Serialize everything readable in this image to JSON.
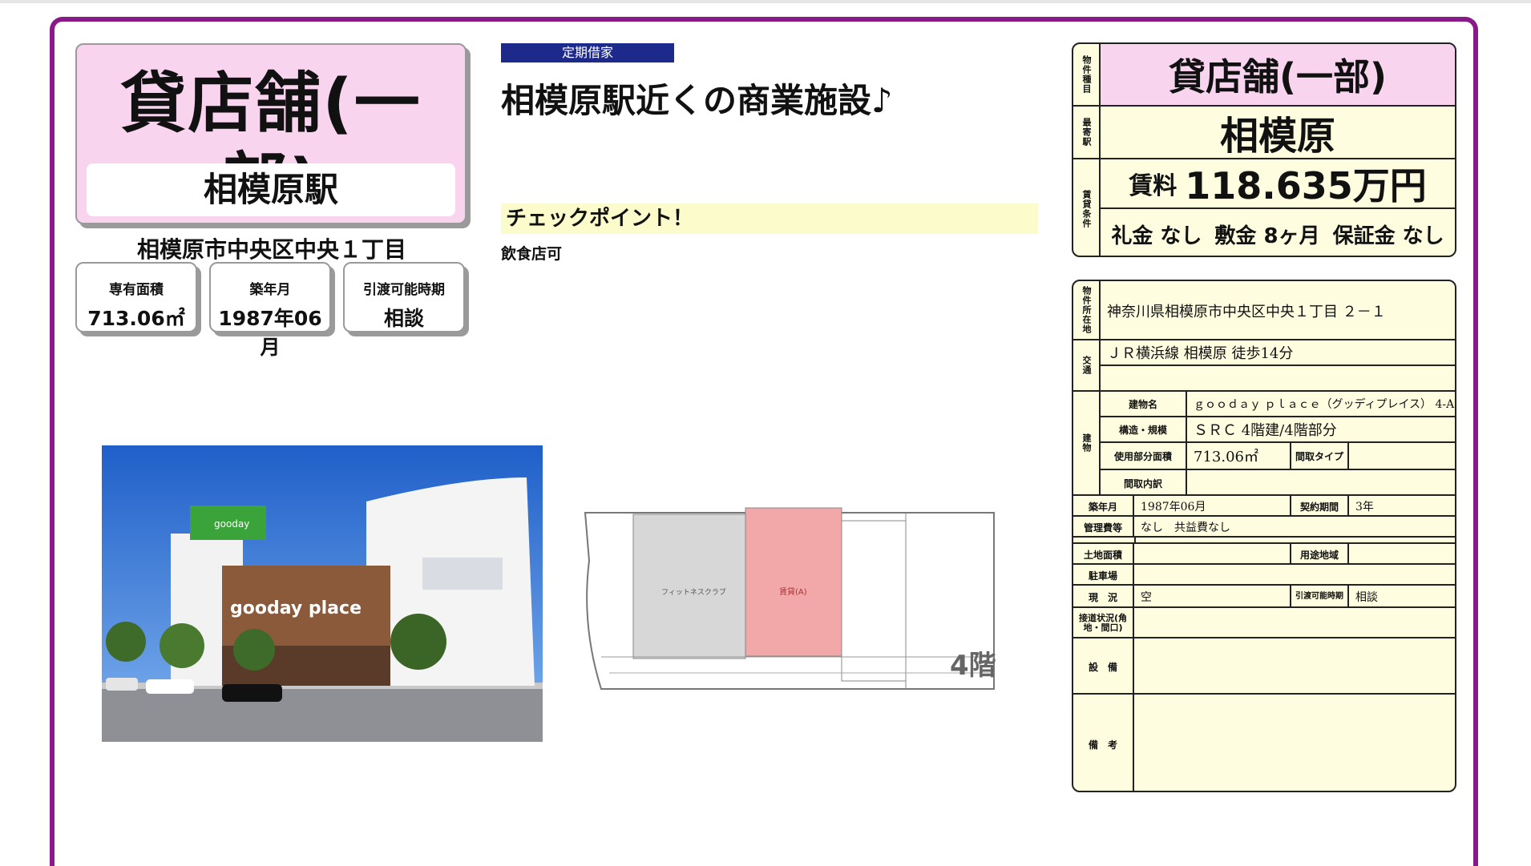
{
  "colors": {
    "frame": "#8a1a8a",
    "title_bg": "#f9d4ef",
    "badge_bg": "#1d2a8c",
    "table_bg": "#fffde0",
    "checkpoint_bg": "#fbfbcb"
  },
  "title_card": {
    "type": "貸店舗(一部)",
    "station": "相模原駅"
  },
  "address": "相模原市中央区中央１丁目",
  "info_boxes": [
    {
      "label": "専有面積",
      "value": "713.06㎡"
    },
    {
      "label": "築年月",
      "value": "1987年06月"
    },
    {
      "label": "引渡可能時期",
      "value": "相談"
    }
  ],
  "badge": "定期借家",
  "catch_copy": "相模原駅近くの商業施設♪",
  "checkpoint": {
    "heading": "チェックポイント！",
    "text": "飲食店可"
  },
  "photo": {
    "sign_text": "gooday place",
    "icon": "building-photo"
  },
  "floorplan": {
    "floor_label": "4階",
    "room_label_1": "フィットネスクラブ",
    "room_label_2": "賃貸(A)"
  },
  "summary": {
    "type_label": "物件種目",
    "type": "貸店舗(一部)",
    "station_label": "最寄駅",
    "station": "相模原",
    "terms_label": "賃貸条件",
    "rent_label": "賃料",
    "rent_value": "118.635万円",
    "key_money": "礼金 なし",
    "deposit": "敷金 8ヶ月",
    "guarantee": "保証金 なし"
  },
  "details": {
    "location_label": "物件所在地",
    "location": "神奈川県相模原市中央区中央１丁目 ２－１",
    "transport_label": "交通",
    "transport": "ＪＲ横浜線 相模原 徒歩14分",
    "building_label": "建物",
    "name_label": "建物名",
    "name": "ｇｏｏｄａｙ ｐｌａｃｅ（グッディプレイス） 4-A",
    "structure_label": "構造・規模",
    "structure": "ＳＲＣ 4階建/4階部分",
    "area_label": "使用部分面積",
    "area": "713.06㎡",
    "layout_type_label": "間取タイプ",
    "layout_type": "",
    "layout_detail_label": "間取内訳",
    "layout_detail": "",
    "built_label": "築年月",
    "built": "1987年06月",
    "contract_label": "契約期間",
    "contract": "3年",
    "fees_label": "管理費等",
    "fees": "なし　共益費なし",
    "land_label": "土地面積",
    "land": "",
    "zoning_label": "用途地域",
    "zoning": "",
    "parking_label": "駐車場",
    "parking": "",
    "status_label": "現　況",
    "status": "空",
    "handover_label": "引渡可能時期",
    "handover": "相談",
    "road_label": "接道状況(角地・間口)",
    "road": "",
    "equipment_label": "設　備",
    "equipment": "",
    "remarks_label": "備　考",
    "remarks": ""
  }
}
